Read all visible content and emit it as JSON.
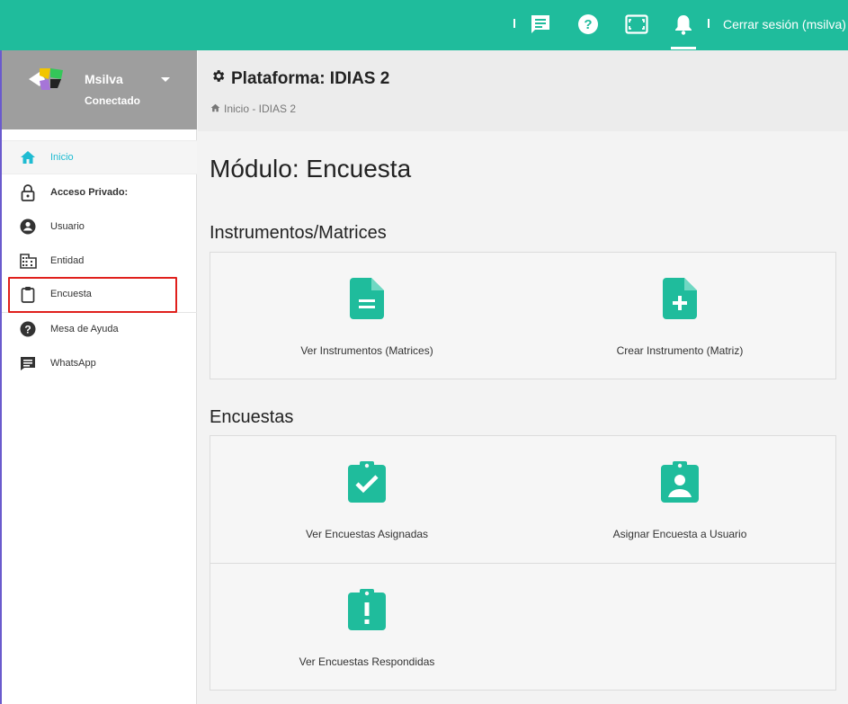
{
  "topbar": {
    "logout_label": "Cerrar sesión (msilva)",
    "icons": [
      "chat-icon",
      "help-icon",
      "fullscreen-icon",
      "bell-icon"
    ],
    "accent_color": "#1fbc9c"
  },
  "profile": {
    "name": "Msilva",
    "status": "Conectado"
  },
  "sidebar": {
    "items": [
      {
        "label": "Inicio",
        "icon": "home-icon"
      },
      {
        "label": "Acceso Privado:",
        "icon": "lock-icon"
      },
      {
        "label": "Usuario",
        "icon": "user-circle-icon"
      },
      {
        "label": "Entidad",
        "icon": "building-icon"
      },
      {
        "label": "Encuesta",
        "icon": "clipboard-icon"
      },
      {
        "label": "Mesa de Ayuda",
        "icon": "help-icon"
      },
      {
        "label": "WhatsApp",
        "icon": "message-icon"
      }
    ]
  },
  "header": {
    "title": "Plataforma: IDIAS 2",
    "breadcrumb": "Inicio - IDIAS 2"
  },
  "main": {
    "module_title": "Módulo: Encuesta",
    "sections": [
      {
        "title": "Instrumentos/Matrices",
        "cards": [
          {
            "label": "Ver Instrumentos (Matrices)",
            "icon": "document-icon"
          },
          {
            "label": "Crear Instrumento (Matriz)",
            "icon": "document-add-icon"
          }
        ]
      },
      {
        "title": "Encuestas",
        "cards": [
          {
            "label": "Ver Encuestas Asignadas",
            "icon": "clipboard-check-icon"
          },
          {
            "label": "Asignar Encuesta a Usuario",
            "icon": "clipboard-user-icon"
          },
          {
            "label": "Ver Encuestas Respondidas",
            "icon": "clipboard-alert-icon"
          }
        ]
      }
    ]
  }
}
